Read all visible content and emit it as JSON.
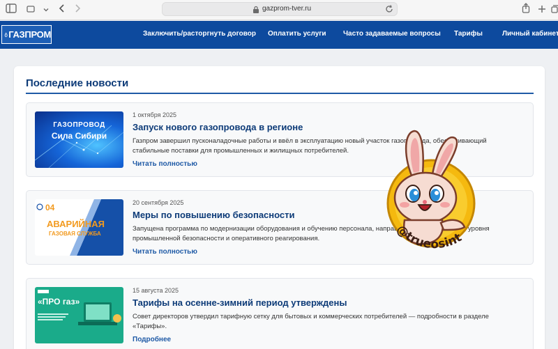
{
  "browser": {
    "url": "gazprom-tver.ru",
    "icons": [
      "sidebar-icon",
      "chevron-down-icon",
      "back-icon",
      "forward-icon",
      "lock-icon",
      "reload-icon",
      "share-icon",
      "new-tab-icon",
      "tabs-icon"
    ]
  },
  "nav": {
    "logo_text": "ГАЗПРОМ",
    "links": [
      "Заключить/расторгнуть договор",
      "Оплатить услуги",
      "Часто задаваемые вопросы",
      "Тарифы",
      "Личный кабинет"
    ]
  },
  "section": {
    "title": "Последние новости"
  },
  "news": [
    {
      "date": "1 октября 2025",
      "title": "Запуск нового газопровода в регионе",
      "description": "Газпром завершил пусконаладочные работы и ввёл в эксплуатацию новый участок газопровода, обеспечивающий стабильные поставки для промышленных и жилищных потребителей.",
      "link": "Читать полностью",
      "thumb": {
        "line1": "ГАЗОПРОВОД",
        "line2": "Сила Сибири"
      }
    },
    {
      "date": "20 сентября 2025",
      "title": "Меры по повышению безопасности",
      "description": "Запущена программа по модернизации оборудования и обучению персонала, направленная на повышение уровня промышленной безопасности и оперативного реагирования.",
      "link": "Читать полностью",
      "thumb": {
        "number": "04",
        "line1": "АВАРИЙНАЯ",
        "line2": "ГАЗОВАЯ СЛУЖБА"
      }
    },
    {
      "date": "15 августа 2025",
      "title": "Тарифы на осенне-зимний период утверждены",
      "description": "Совет директоров утвердил тарифную сетку для бытовых и коммерческих потребителей — подробности в разделе «Тарифы».",
      "link": "Подробнее",
      "thumb": {
        "line1": "«ПРО газ»"
      }
    }
  ],
  "sticker": {
    "text": "@trueosint"
  },
  "colors": {
    "nav_bg": "#0d4a9e",
    "title": "#0d3b78",
    "accent": "#1f5aa6"
  }
}
